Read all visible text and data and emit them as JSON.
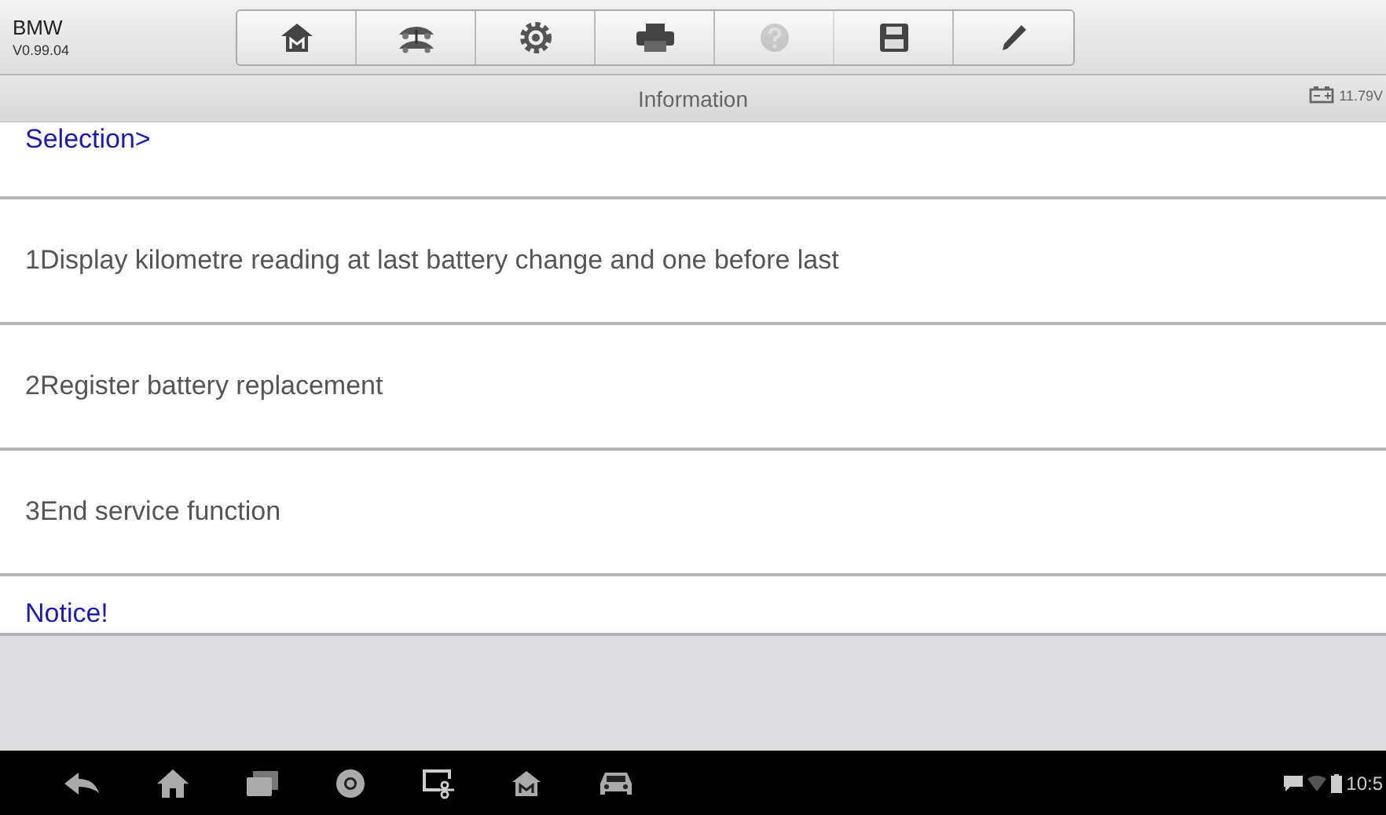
{
  "app": {
    "title": "BMW",
    "version": "V0.99.04"
  },
  "toolbar": [
    {
      "kind": "home",
      "disabled": false
    },
    {
      "kind": "vehicle",
      "disabled": false
    },
    {
      "kind": "settings",
      "disabled": false
    },
    {
      "kind": "print",
      "disabled": false
    },
    {
      "kind": "help",
      "disabled": true
    },
    {
      "kind": "save",
      "disabled": false
    },
    {
      "kind": "edit",
      "disabled": false
    }
  ],
  "header": {
    "title": "Information",
    "voltage": "11.79V"
  },
  "items": [
    {
      "kind": "heading",
      "text": "Selection>"
    },
    {
      "kind": "option",
      "text": "1Display kilometre reading at last battery change and one before last"
    },
    {
      "kind": "option",
      "text": "2Register battery replacement"
    },
    {
      "kind": "option",
      "text": "3End service function"
    },
    {
      "kind": "notice",
      "text": "Notice!"
    }
  ],
  "nav": [
    {
      "kind": "back"
    },
    {
      "kind": "home"
    },
    {
      "kind": "recents"
    },
    {
      "kind": "browser"
    },
    {
      "kind": "screenshot"
    },
    {
      "kind": "launcher"
    },
    {
      "kind": "car"
    }
  ],
  "status_bar": {
    "time": "10:5"
  }
}
